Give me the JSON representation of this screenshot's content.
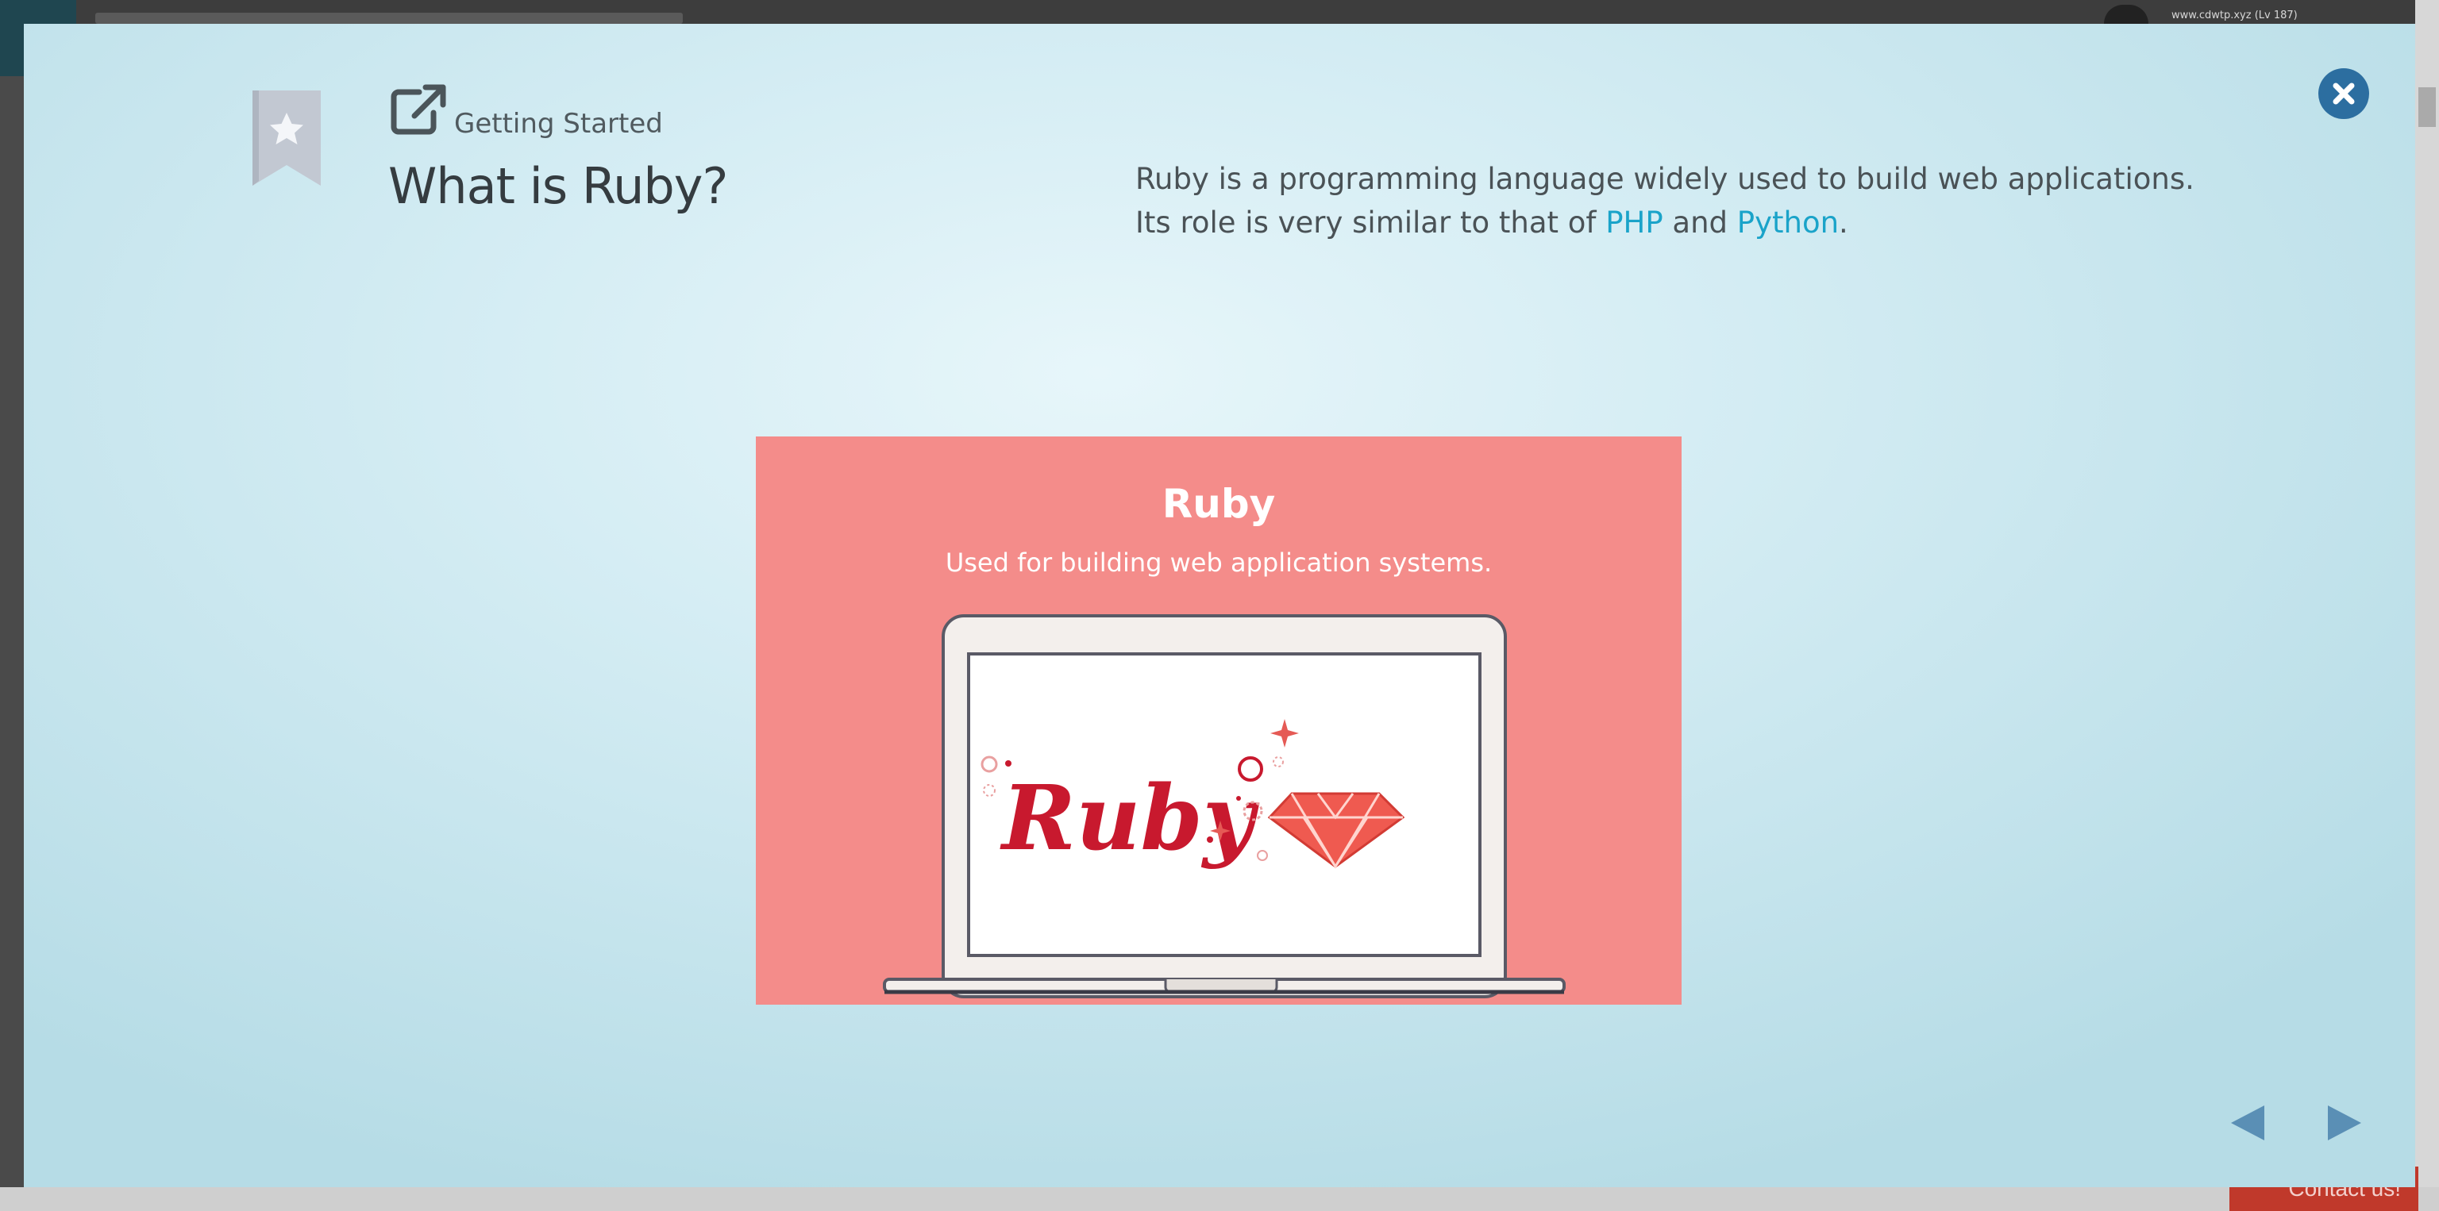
{
  "background": {
    "url_text": "www.cdwtp.xyz (Lv 187)",
    "contact_label": "Contact us!"
  },
  "modal": {
    "breadcrumb": "Getting Started",
    "title": "What is Ruby?",
    "description": {
      "line1": "Ruby is a programming language widely used to build web applications.",
      "line2_prefix": "Its role is very similar to that of ",
      "link1": "PHP",
      "conjunction": " and ",
      "link2": "Python",
      "suffix": "."
    },
    "illustration": {
      "heading": "Ruby",
      "subheading": "Used for building web application systems.",
      "logo_text": "Ruby"
    },
    "icons": {
      "bookmark": "bookmark-star-icon",
      "external": "external-link-icon",
      "close": "close-icon",
      "prev": "arrow-left-icon",
      "next": "arrow-right-icon"
    },
    "colors": {
      "accent": "#2c6ea0",
      "link": "#1aa3c9",
      "illustration_bg": "#f48c8a",
      "ruby_red": "#c8192e",
      "gem": "#ee5a4f"
    }
  }
}
